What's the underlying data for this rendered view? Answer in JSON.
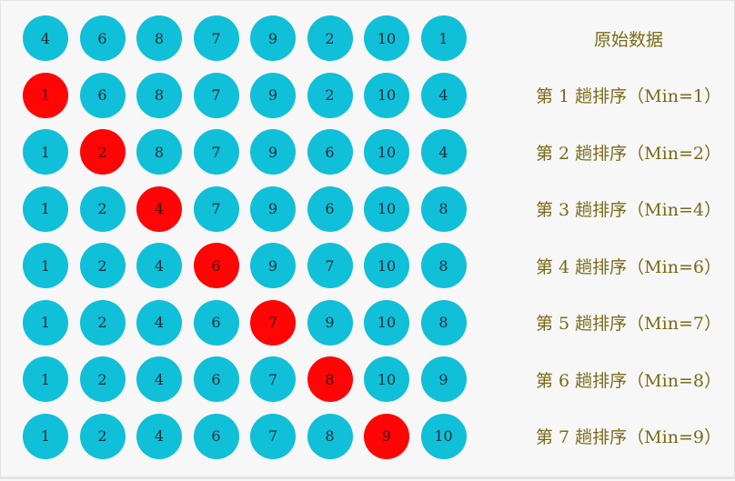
{
  "rows": [
    {
      "label": "原始数据",
      "values": [
        4,
        6,
        8,
        7,
        9,
        2,
        10,
        1
      ],
      "highlight": -1
    },
    {
      "label": "第 1 趟排序（Min=1）",
      "values": [
        1,
        6,
        8,
        7,
        9,
        2,
        10,
        4
      ],
      "highlight": 0
    },
    {
      "label": "第 2 趟排序（Min=2）",
      "values": [
        1,
        2,
        8,
        7,
        9,
        6,
        10,
        4
      ],
      "highlight": 1
    },
    {
      "label": "第 3 趟排序（Min=4）",
      "values": [
        1,
        2,
        4,
        7,
        9,
        6,
        10,
        8
      ],
      "highlight": 2
    },
    {
      "label": "第 4 趟排序（Min=6）",
      "values": [
        1,
        2,
        4,
        6,
        9,
        7,
        10,
        8
      ],
      "highlight": 3
    },
    {
      "label": "第 5 趟排序（Min=7）",
      "values": [
        1,
        2,
        4,
        6,
        7,
        9,
        10,
        8
      ],
      "highlight": 4
    },
    {
      "label": "第 6 趟排序（Min=8）",
      "values": [
        1,
        2,
        4,
        6,
        7,
        8,
        10,
        9
      ],
      "highlight": 5
    },
    {
      "label": "第 7 趟排序（Min=9）",
      "values": [
        1,
        2,
        4,
        6,
        7,
        8,
        9,
        10
      ],
      "highlight": 6
    }
  ],
  "colors": {
    "ball": "#10bfd8",
    "min_ball": "#ff0505",
    "label_text": "#7a6a16"
  }
}
